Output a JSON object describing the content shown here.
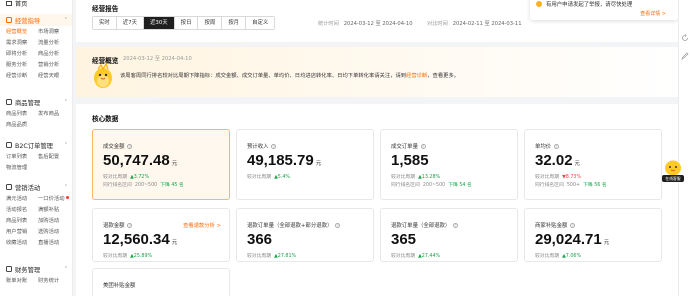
{
  "sidebar": {
    "home": "首页",
    "sections": [
      {
        "label": "经营指导",
        "active": true,
        "items": [
          {
            "label": "经营概览",
            "on": true
          },
          {
            "label": "市场洞察"
          },
          {
            "label": "需求洞察"
          },
          {
            "label": "流量分析"
          },
          {
            "label": "即将分析"
          },
          {
            "label": "商品分析"
          },
          {
            "label": "服务分析"
          },
          {
            "label": "营销分析"
          },
          {
            "label": "经营诊断"
          },
          {
            "label": "经营天眼"
          }
        ]
      },
      {
        "label": "商品管理",
        "items": [
          {
            "label": "商品列表"
          },
          {
            "label": "发布商品"
          },
          {
            "label": "商品品质"
          }
        ]
      },
      {
        "label": "B2C订单管理",
        "items": [
          {
            "label": "订单列表"
          },
          {
            "label": "售后配置"
          },
          {
            "label": "物流管理"
          }
        ]
      },
      {
        "label": "营销活动",
        "items": [
          {
            "label": "满元活动"
          },
          {
            "label": "一口价活动",
            "dot": true
          },
          {
            "label": "活动报名"
          },
          {
            "label": "满额补贴"
          },
          {
            "label": "商品列表"
          },
          {
            "label": "加购活动"
          },
          {
            "label": "用户营销"
          },
          {
            "label": "选购活动"
          },
          {
            "label": "收藏活动"
          },
          {
            "label": "直播活动"
          }
        ]
      },
      {
        "label": "财务管理",
        "items": [
          {
            "label": "账单对账"
          },
          {
            "label": "财务统计"
          }
        ]
      }
    ]
  },
  "header": {
    "title": "经营报告",
    "tabs": [
      "实时",
      "近7天",
      "近30天",
      "按日",
      "按周",
      "按月",
      "自定义"
    ],
    "active_tab": 2,
    "stat_label": "统计时间",
    "stat_range": "2024-03-12 至 2024-04-10",
    "cmp_label": "对比时间",
    "cmp_range": "2024-02-11 至 2024-03-11"
  },
  "notice": {
    "text": "有用户申请发起了举报，请尽快处理",
    "link": "查看详情 >"
  },
  "banner": {
    "title": "经营概览",
    "date": "2024-03-12 至 2024-04-10",
    "text": "该周客周同行排名较对比周期下降指标：成交金额、成交订单量、单均价、日均进店转化率、日均下单转化率请关注，请到",
    "link": "经营诊断",
    "tail": "，查看更多。"
  },
  "core": {
    "title": "核心数据",
    "cards": [
      {
        "name": "成交金额",
        "value": "50,747.48",
        "unit": "元",
        "cmp": "较对比周期",
        "delta": "3.72%",
        "dir": "up",
        "rank_label": "同行排名区间",
        "rank": "200~500",
        "rank_delta": "下降 45 名",
        "rank_dir": "down_green",
        "selected": true
      },
      {
        "name": "预计收入",
        "value": "49,185.79",
        "unit": "元",
        "cmp": "较对比周期",
        "delta": "5.4%",
        "dir": "up"
      },
      {
        "name": "成交订单量",
        "value": "1,585",
        "unit": "",
        "cmp": "较对比周期",
        "delta": "13.28%",
        "dir": "up",
        "rank_label": "同行排名区间",
        "rank": "200~500",
        "rank_delta": "下降 54 名",
        "rank_dir": "down_green"
      },
      {
        "name": "单均价",
        "value": "32.02",
        "unit": "元",
        "cmp": "较对比周期",
        "delta": "8.73%",
        "dir": "down",
        "rank_label": "同行排名区间",
        "rank": "500+",
        "rank_delta": "下降 56 名",
        "rank_dir": "down_green"
      },
      {
        "name": "退款金额",
        "value": "12,560.34",
        "unit": "元",
        "cmp": "较对比周期",
        "delta": "25.89%",
        "dir": "up",
        "link": "查看退款分析 >"
      },
      {
        "name": "退款订单量（全部退款+部分退款）",
        "value": "366",
        "unit": "",
        "cmp": "较对比周期",
        "delta": "27.81%",
        "dir": "up"
      },
      {
        "name": "退款订单量（全部退款）",
        "value": "365",
        "unit": "",
        "cmp": "较对比周期",
        "delta": "27.44%",
        "dir": "up"
      },
      {
        "name": "商家补贴金额",
        "value": "29,024.71",
        "unit": "元",
        "cmp": "较对比周期",
        "delta": "7.06%",
        "dir": "up"
      },
      {
        "name": "美团补贴金额"
      }
    ]
  },
  "floating": {
    "label": "在线客服"
  }
}
